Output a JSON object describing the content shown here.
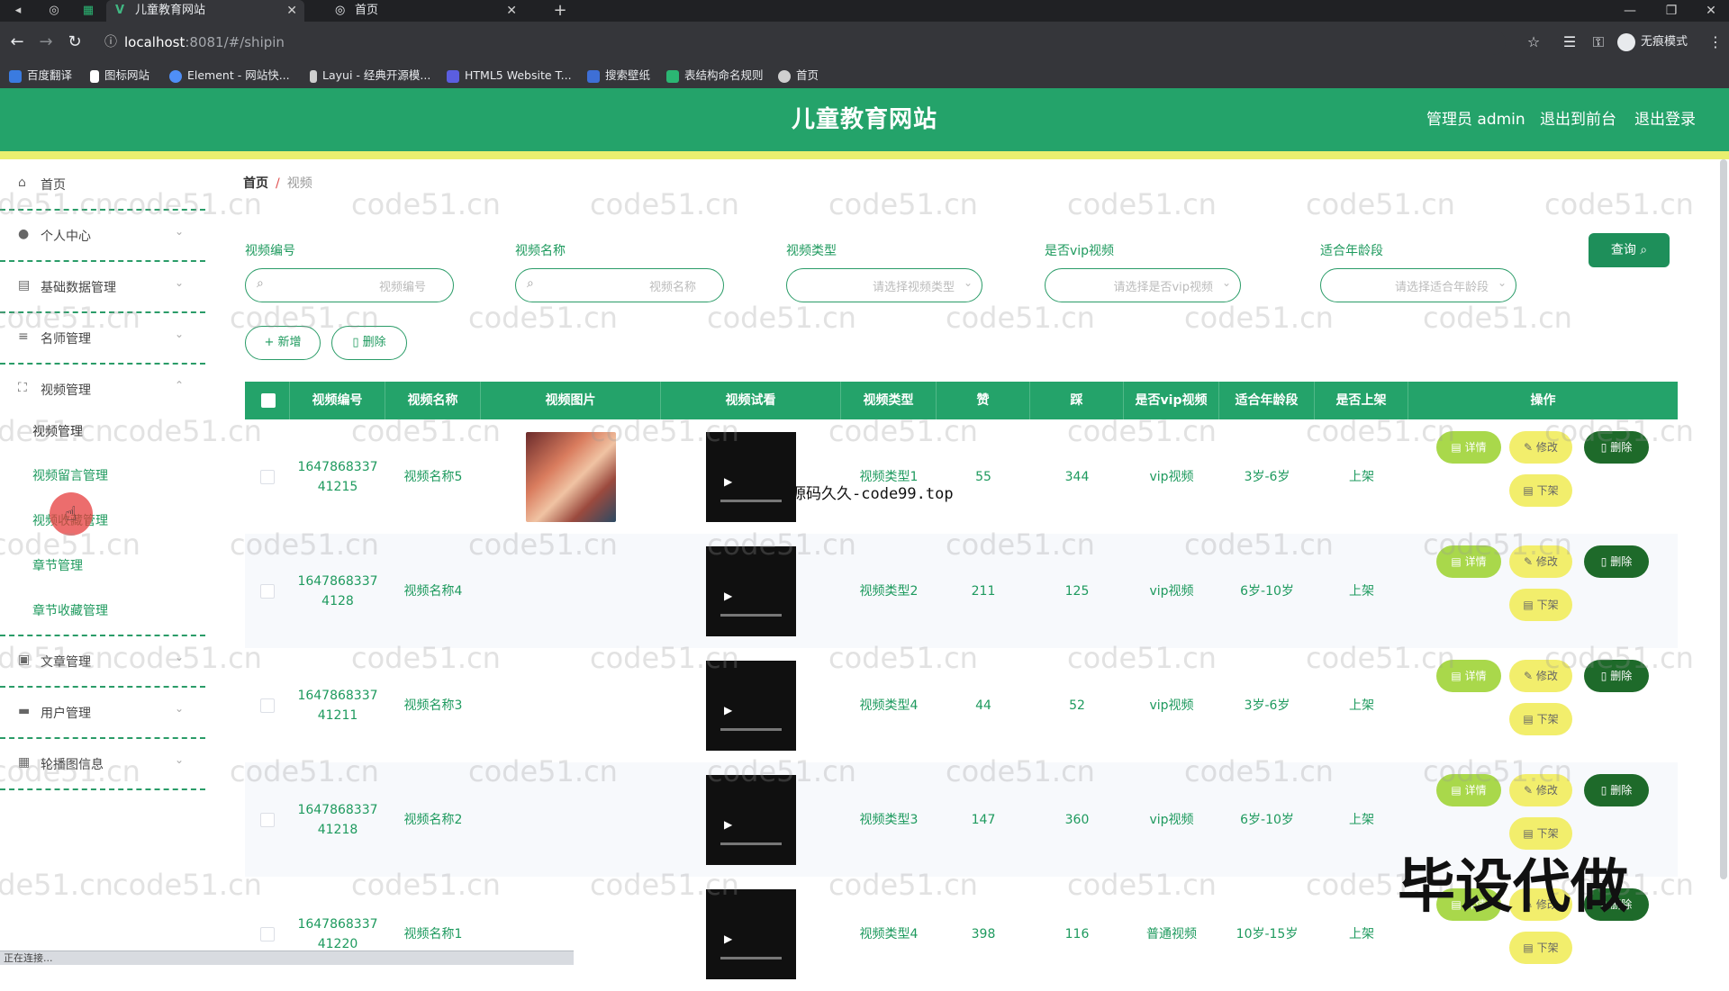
{
  "browser": {
    "tabs": [
      {
        "label": "儿童教育网站",
        "active": true
      },
      {
        "label": "首页",
        "active": false
      }
    ],
    "url_host": "localhost",
    "url_rest": ":8081/#/shipin",
    "profile_label": "无痕模式",
    "bookmarks": [
      "百度翻译",
      "图标网站",
      "Element - 网站快...",
      "Layui - 经典开源模...",
      "HTML5 Website T...",
      "搜索壁纸",
      "表结构命名规则",
      "首页"
    ]
  },
  "header": {
    "title": "儿童教育网站",
    "admin_label": "管理员 admin",
    "front_label": "退出到前台",
    "logout_label": "退出登录"
  },
  "sidebar": {
    "items": [
      {
        "label": "首页",
        "icon": "home-icon"
      },
      {
        "label": "个人中心",
        "icon": "user-icon"
      },
      {
        "label": "基础数据管理",
        "icon": "chat-icon"
      },
      {
        "label": "名师管理",
        "icon": "list-icon"
      },
      {
        "label": "视频管理",
        "icon": "expand-icon"
      },
      {
        "label": "文章管理",
        "icon": "image-icon"
      },
      {
        "label": "用户管理",
        "icon": "users-icon"
      },
      {
        "label": "轮播图信息",
        "icon": "grid-icon"
      }
    ],
    "video_submenu": [
      "视频管理",
      "视频留言管理",
      "视频收藏管理",
      "章节管理",
      "章节收藏管理"
    ]
  },
  "breadcrumb": {
    "home": "首页",
    "current": "视频"
  },
  "filters": [
    {
      "label": "视频编号",
      "placeholder": "视频编号"
    },
    {
      "label": "视频名称",
      "placeholder": "视频名称"
    },
    {
      "label": "视频类型",
      "placeholder": "请选择视频类型"
    },
    {
      "label": "是否vip视频",
      "placeholder": "请选择是否vip视频"
    },
    {
      "label": "适合年龄段",
      "placeholder": "请选择适合年龄段"
    }
  ],
  "query_label": "查询",
  "actions": {
    "add": "+ 新增",
    "delete": "删除"
  },
  "table": {
    "columns": [
      "视频编号",
      "视频名称",
      "视频图片",
      "视频试看",
      "视频类型",
      "赞",
      "踩",
      "是否vip视频",
      "适合年龄段",
      "是否上架",
      "操作"
    ],
    "rows": [
      {
        "id": "1647868337 41215",
        "name": "视频名称5",
        "type": "视频类型1",
        "like": "55",
        "dislike": "344",
        "vip": "vip视频",
        "age": "3岁-6岁",
        "onsale": "上架",
        "has_image": true
      },
      {
        "id": "1647868337 4128",
        "name": "视频名称4",
        "type": "视频类型2",
        "like": "211",
        "dislike": "125",
        "vip": "vip视频",
        "age": "6岁-10岁",
        "onsale": "上架",
        "has_image": false
      },
      {
        "id": "1647868337 41211",
        "name": "视频名称3",
        "type": "视频类型4",
        "like": "44",
        "dislike": "52",
        "vip": "vip视频",
        "age": "3岁-6岁",
        "onsale": "上架",
        "has_image": false
      },
      {
        "id": "1647868337 41218",
        "name": "视频名称2",
        "type": "视频类型3",
        "like": "147",
        "dislike": "360",
        "vip": "vip视频",
        "age": "6岁-10岁",
        "onsale": "上架",
        "has_image": false
      },
      {
        "id": "1647868337 41220",
        "name": "视频名称1",
        "type": "视频类型4",
        "like": "398",
        "dislike": "116",
        "vip": "普通视频",
        "age": "10岁-15岁",
        "onsale": "上架",
        "has_image": false
      }
    ],
    "op_labels": {
      "detail": "详情",
      "edit": "修改",
      "delete": "删除",
      "down": "下架"
    }
  },
  "watermarks": {
    "tile": "code51.cn",
    "site": "源码久久-code99.top",
    "big": "毕设代做"
  },
  "status_text": "正在连接...",
  "colors": {
    "primary": "#24a36a",
    "accent_yellow": "#e9ef6f",
    "dark_green": "#1e6a2a"
  }
}
